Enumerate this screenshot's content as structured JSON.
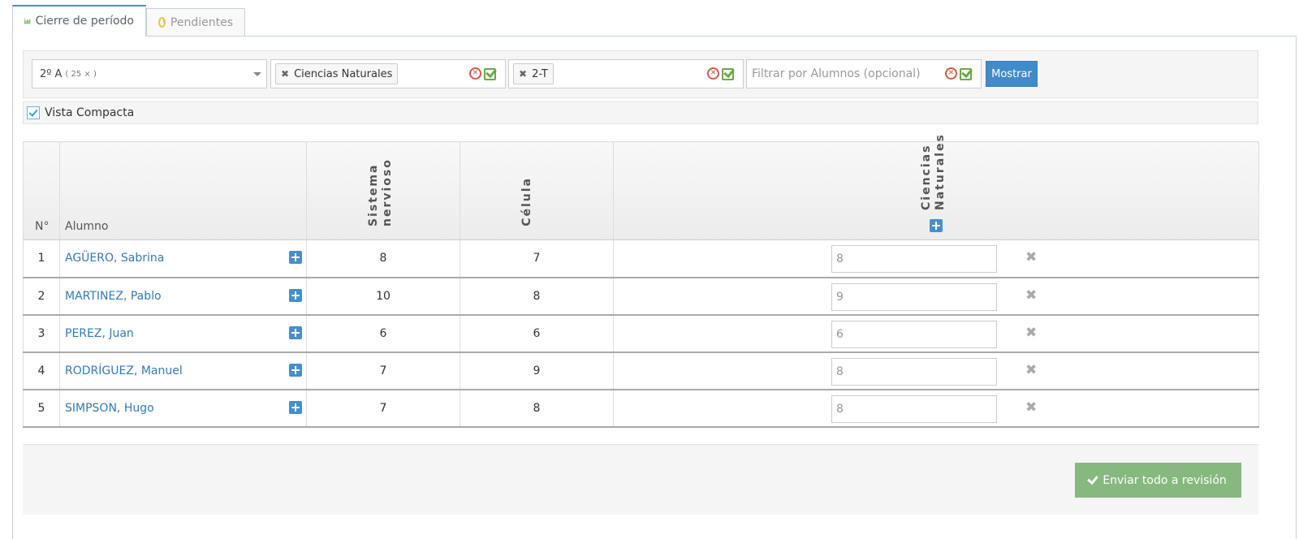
{
  "tabs": [
    {
      "label": "Cierre de período",
      "icon": "bar-chart-icon",
      "active": true
    },
    {
      "label": "Pendientes",
      "icon": "clock-icon",
      "active": false
    }
  ],
  "filters": {
    "course": {
      "label": "2º A",
      "count": "( 25 × )"
    },
    "subject_chip": "Ciencias Naturales",
    "period_chip": "2-T",
    "student_placeholder": "Filtrar por Alumnos (opcional)",
    "show_button": "Mostrar"
  },
  "compact_view": {
    "label": "Vista Compacta",
    "checked": true
  },
  "table": {
    "headers": {
      "number": "N°",
      "student": "Alumno",
      "col1": "Sistema nervioso",
      "col2": "Célula",
      "col3": "Ciencias Naturales"
    },
    "rows": [
      {
        "no": "1",
        "name": "AGÜERO, Sabrina",
        "sistema": "8",
        "celula": "7",
        "grade": "8"
      },
      {
        "no": "2",
        "name": "MARTINEZ, Pablo",
        "sistema": "10",
        "celula": "8",
        "grade": "9"
      },
      {
        "no": "3",
        "name": "PEREZ, Juan",
        "sistema": "6",
        "celula": "6",
        "grade": "6"
      },
      {
        "no": "4",
        "name": "RODRÍGUEZ, Manuel",
        "sistema": "7",
        "celula": "9",
        "grade": "8"
      },
      {
        "no": "5",
        "name": "SIMPSON, Hugo",
        "sistema": "7",
        "celula": "8",
        "grade": "8"
      }
    ]
  },
  "footer": {
    "send_button": "Enviar todo a revisión"
  },
  "colors": {
    "primary": "#428bca",
    "success": "#87b87f",
    "link": "#337ab7",
    "danger": "#d15b47"
  }
}
